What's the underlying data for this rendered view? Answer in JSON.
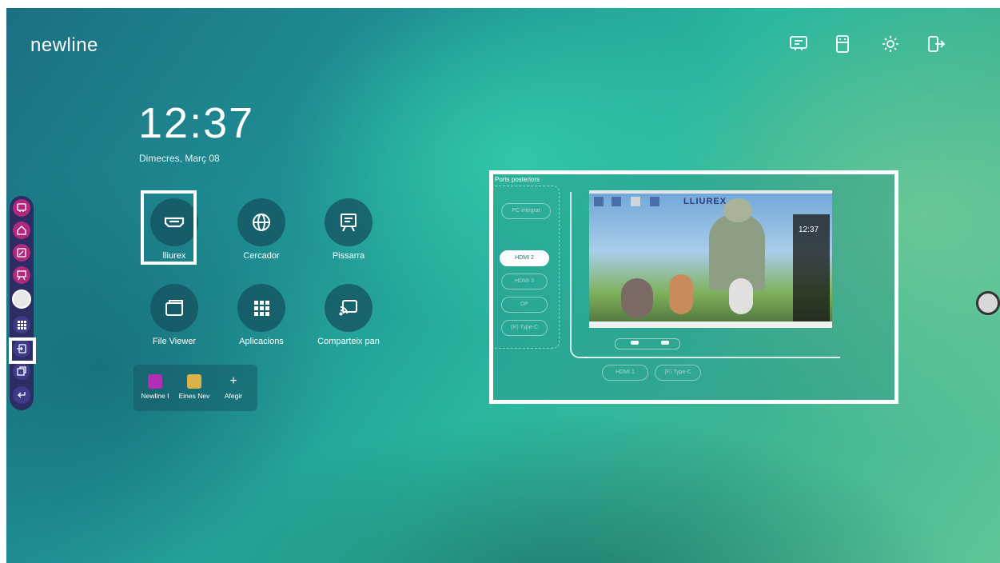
{
  "brand": "newline",
  "clock": {
    "time": "12:37",
    "date": "Dimecres, Març 08"
  },
  "top_icons": [
    "board-icon",
    "usb-icon",
    "gear-icon",
    "exit-icon"
  ],
  "apps": [
    {
      "label": "lliurex",
      "icon": "hdmi-icon"
    },
    {
      "label": "Cercador",
      "icon": "globe-icon"
    },
    {
      "label": "Pissarra",
      "icon": "whiteboard-icon"
    },
    {
      "label": "File Viewer",
      "icon": "folder-icon"
    },
    {
      "label": "Aplicacions",
      "icon": "grid-icon"
    },
    {
      "label": "Comparteix pan",
      "icon": "cast-icon"
    }
  ],
  "dock": [
    {
      "label": "Newline I",
      "icon": "newline-app-icon",
      "color": "#b12fb5"
    },
    {
      "label": "Eines Nev",
      "icon": "tools-app-icon",
      "color": "#d9b24a"
    },
    {
      "label": "Afegir",
      "icon": "plus-icon"
    }
  ],
  "sidebar_icons": [
    "annotate-icon",
    "home-icon",
    "edit-icon",
    "board-icon",
    "round-button-icon",
    "apps-icon",
    "input-source-icon",
    "windows-icon",
    "back-icon"
  ],
  "preview": {
    "title": "Ports posteriors",
    "ports": [
      "PC integrat",
      "HDMI 2",
      "HDMI 3",
      "DP",
      "(R) Type-C"
    ],
    "bottom_ports": [
      "HDMI 1",
      "(F) Type-C"
    ],
    "inner_brand": "LLIUREX",
    "inner_time": "12:37"
  },
  "colors": {
    "sidebar_bg": "#2c2d63",
    "sidebar_pink": "#b0297f",
    "highlight": "#ffffff"
  }
}
